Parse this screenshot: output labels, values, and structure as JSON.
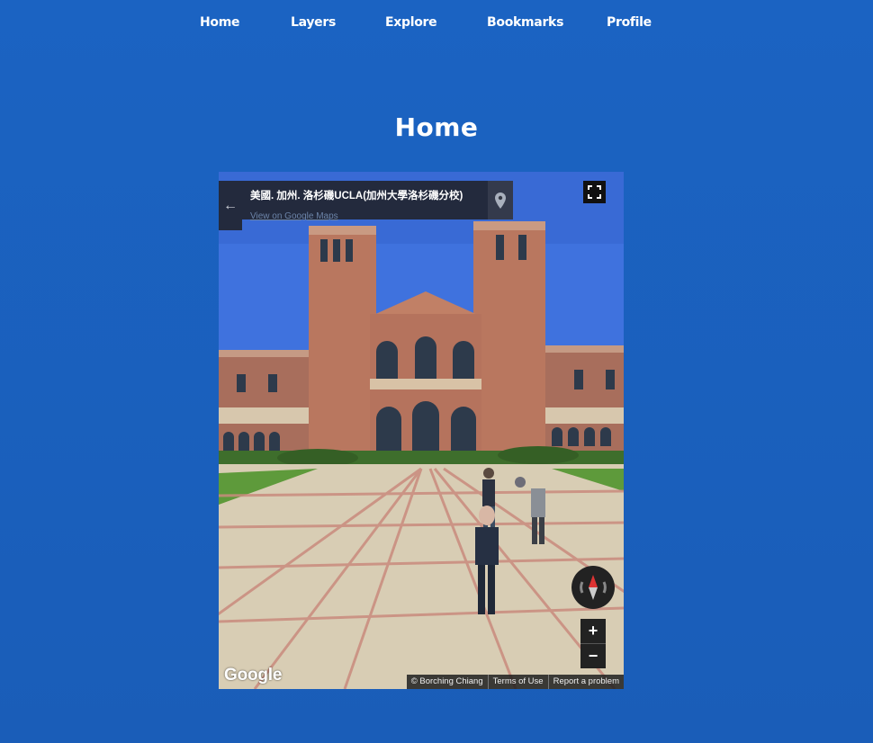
{
  "nav": {
    "items": [
      {
        "label": "Home"
      },
      {
        "label": "Layers"
      },
      {
        "label": "Explore"
      },
      {
        "label": "Bookmarks"
      },
      {
        "label": "Profile"
      }
    ]
  },
  "page": {
    "title": "Home"
  },
  "streetview": {
    "place_name": "美國. 加州. 洛杉磯UCLA(加州大學洛杉磯分校)",
    "view_link": "View on Google Maps",
    "back_icon": "arrow-left-icon",
    "pin_icon": "map-pin-icon",
    "fullscreen_icon": "fullscreen-icon",
    "compass_icon": "compass-icon",
    "zoom_in": "+",
    "zoom_out": "−",
    "logo": "Google",
    "attribution": [
      "© Borching Chiang",
      "Terms of Use",
      "Report a problem"
    ],
    "colors": {
      "sky": "#3f72de",
      "brick": "#b9775f",
      "plaza": "#d8cdb4",
      "brick_line": "#c98b7d",
      "lawn": "#5e9a3b"
    }
  }
}
